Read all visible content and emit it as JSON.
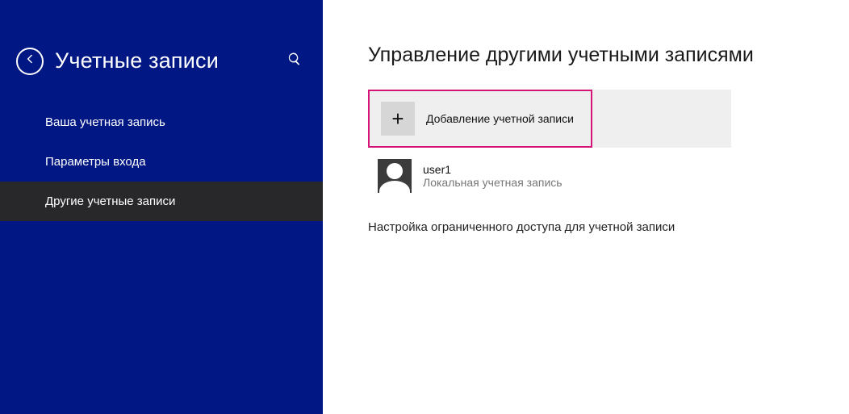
{
  "sidebar": {
    "title": "Учетные записи",
    "items": [
      {
        "label": "Ваша учетная запись",
        "active": false
      },
      {
        "label": "Параметры входа",
        "active": false
      },
      {
        "label": "Другие учетные записи",
        "active": true
      }
    ]
  },
  "main": {
    "title": "Управление другими учетными записями",
    "add_account_label": "Добавление учетной записи",
    "user": {
      "name": "user1",
      "type": "Локальная учетная запись"
    },
    "restricted_link": "Настройка ограниченного доступа для учетной записи"
  }
}
